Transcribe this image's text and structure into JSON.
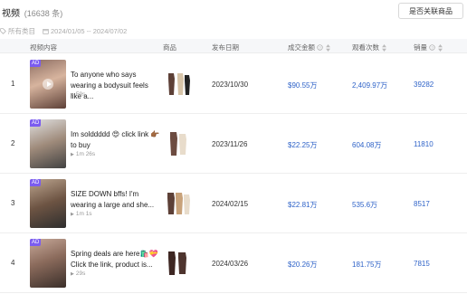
{
  "header": {
    "title": "视频",
    "count": "(16638 条)",
    "related_button": "是否关联商品"
  },
  "filters": {
    "category": "所有类目",
    "date_range": "2024/01/05 -- 2024/07/02"
  },
  "columns": {
    "content": "视频内容",
    "product": "商品",
    "date": "发布日期",
    "gmv": "成交金额",
    "views": "观看次数",
    "sales": "销量"
  },
  "colors": {
    "accent_blue": "#2f63c8",
    "ad_badge": "#7b5cf0"
  },
  "rows": [
    {
      "index": "1",
      "ad_label": "AD",
      "desc": "To anyone who says wearing a bodysuit feels like a...",
      "duration": "59s",
      "date": "2023/10/30",
      "gmv": "$90.55万",
      "views": "2,409.97万",
      "sales": "39282"
    },
    {
      "index": "2",
      "ad_label": "AD",
      "desc": "Im solddddd 😍 click link 👉🏾 to buy",
      "duration": "1m 26s",
      "date": "2023/11/26",
      "gmv": "$22.25万",
      "views": "604.08万",
      "sales": "11810"
    },
    {
      "index": "3",
      "ad_label": "AD",
      "desc": "SIZE DOWN bffs! I'm wearing a large and she...",
      "duration": "1m 1s",
      "date": "2024/02/15",
      "gmv": "$22.81万",
      "views": "535.6万",
      "sales": "8517"
    },
    {
      "index": "4",
      "ad_label": "AD",
      "desc": "Spring deals are here🛍️💝 Click the link, product is...",
      "duration": "29s",
      "date": "2024/03/26",
      "gmv": "$20.26万",
      "views": "181.75万",
      "sales": "7815"
    }
  ]
}
